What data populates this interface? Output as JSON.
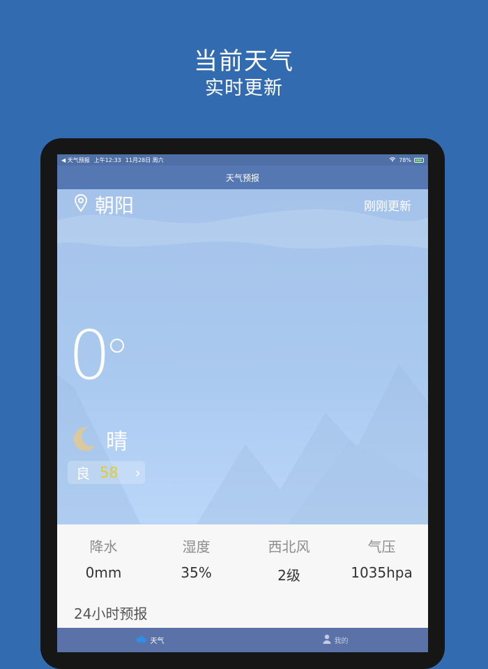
{
  "promo": {
    "title": "当前天气",
    "subtitle": "实时更新"
  },
  "status_bar": {
    "back_app": "◀ 天气预报",
    "time": "上午12:33",
    "date": "11月28日 周六",
    "battery": "78%",
    "battery_level": 0.78
  },
  "nav": {
    "title": "天气预报"
  },
  "weather": {
    "city": "朝阳",
    "updated": "刚刚更新",
    "temperature": "0",
    "condition": "晴",
    "aqi_level": "良",
    "aqi_value": "58"
  },
  "stats": [
    {
      "label": "降水",
      "value": "0mm"
    },
    {
      "label": "湿度",
      "value": "35%"
    },
    {
      "label": "西北风",
      "value": "2级"
    },
    {
      "label": "气压",
      "value": "1035hpa"
    }
  ],
  "forecast_label": "24小时预报",
  "tabs": [
    {
      "label": "天气",
      "icon": "cloud-icon",
      "active": true
    },
    {
      "label": "我的",
      "icon": "person-icon",
      "active": false
    }
  ],
  "colors": {
    "background": "#336bb0",
    "nav": "#5577b2",
    "aqi_value": "#e0cd2c",
    "tabbar": "#5b72a8"
  }
}
